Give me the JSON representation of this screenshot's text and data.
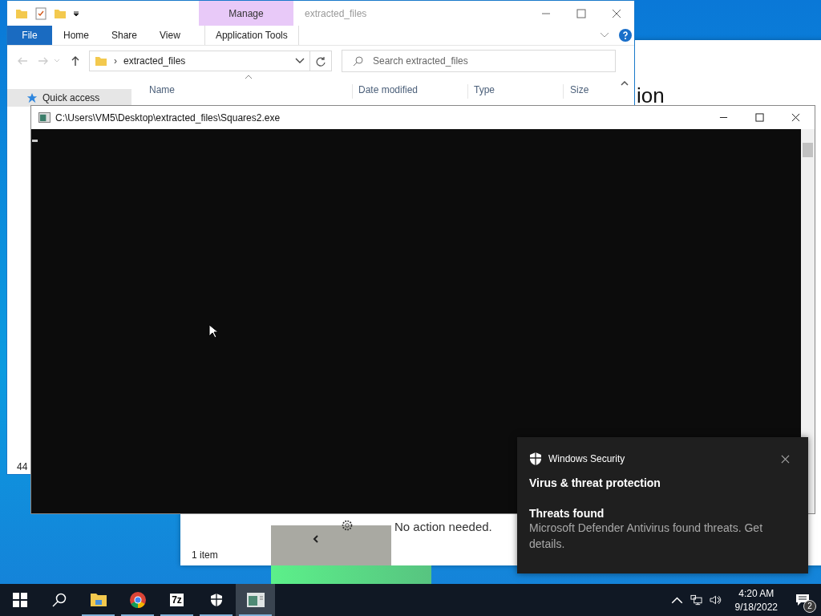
{
  "explorer_window": {
    "title": "extracted_files",
    "contextual_group": "Manage",
    "ribbon_tabs": [
      {
        "label": "File",
        "kind": "file"
      },
      {
        "label": "Home",
        "kind": "normal"
      },
      {
        "label": "Share",
        "kind": "normal"
      },
      {
        "label": "View",
        "kind": "normal"
      },
      {
        "label": "Application Tools",
        "kind": "contextual"
      }
    ],
    "address_separator": "›",
    "address": "extracted_files",
    "search": {
      "placeholder": "Search extracted_files"
    },
    "columns": [
      "Name",
      "Date modified",
      "Type",
      "Size"
    ],
    "nav_items": [
      "Quick access"
    ],
    "status_bar": "44"
  },
  "background_window": {
    "heading_fragment": "ion",
    "message": "No action needed.",
    "status_bar": "1 item"
  },
  "console_window": {
    "title": "C:\\Users\\VM5\\Desktop\\extracted_files\\Squares2.exe"
  },
  "notification": {
    "app": "Windows Security",
    "title": "Virus & threat protection",
    "subtitle": "Threats found",
    "body": "Microsoft Defender Antivirus found threats. Get details."
  },
  "taskbar": {
    "apps": [
      {
        "kind": "start",
        "running": false,
        "selected": false
      },
      {
        "kind": "search",
        "running": false,
        "selected": false
      },
      {
        "kind": "explorer",
        "running": true,
        "selected": false
      },
      {
        "kind": "chrome",
        "running": true,
        "selected": false
      },
      {
        "kind": "archiver",
        "label": "7z",
        "running": true,
        "selected": false
      },
      {
        "kind": "security",
        "running": true,
        "selected": false
      },
      {
        "kind": "console",
        "running": true,
        "selected": true
      }
    ],
    "time": "4:20 AM",
    "date": "9/18/2022",
    "notification_count": "2"
  }
}
